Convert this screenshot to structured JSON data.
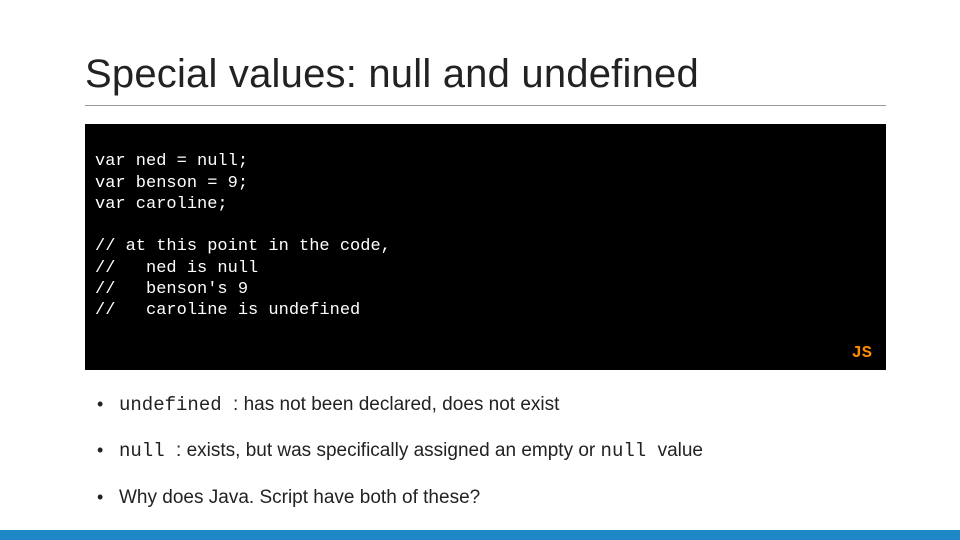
{
  "title": "Special values: null and undefined",
  "code": {
    "lines": [
      "var ned = null;",
      "var benson = 9;",
      "var caroline;",
      "",
      "// at this point in the code,",
      "//   ned is null",
      "//   benson's 9",
      "//   caroline is undefined"
    ],
    "lang_tag": "JS"
  },
  "bullets": [
    {
      "code": "undefined ",
      "text": ": has not been declared, does not exist"
    },
    {
      "code": "null ",
      "text": ": exists, but was specifically assigned an empty or ",
      "code2": "null ",
      "text2": "value"
    },
    {
      "plain": "Why does Java. Script have both of these?"
    }
  ],
  "accent_color": "#1e88c7"
}
